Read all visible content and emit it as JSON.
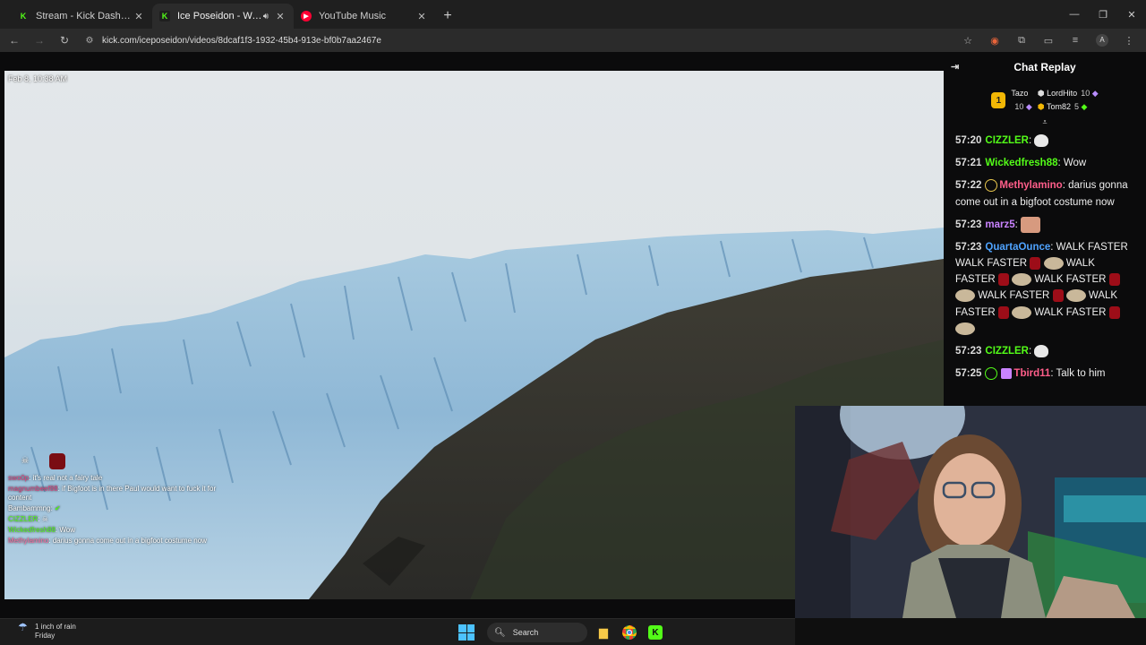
{
  "browser": {
    "tabs": [
      {
        "title": "Stream - Kick Dashboard",
        "favicon": "kick-icon",
        "active": false
      },
      {
        "title": "Ice Poseidon - Watch the V",
        "favicon": "kick-icon",
        "active": true
      },
      {
        "title": "YouTube Music",
        "favicon": "youtube-music-icon",
        "active": false
      }
    ],
    "url": "kick.com/iceposeidon/videos/8dcaf1f3-1932-45b4-913e-bf0b7aa2467e"
  },
  "video": {
    "timestamp": "Feb 8, 10:38 AM",
    "overlay_chat": [
      {
        "user": "swo0p",
        "text": "it's real not a fairy tale"
      },
      {
        "user": "magnumbeef88",
        "text": "if Bigfoot is in there Paul would want to fuck it for content"
      },
      {
        "user": "Bambammng",
        "text": ""
      },
      {
        "user": "CIZZLER",
        "text": ""
      },
      {
        "user": "Wickedfresh88",
        "text": "Wow"
      },
      {
        "user": "Methylamino",
        "text": "darius gonna come out in a bigfoot costume now"
      }
    ],
    "overlay_badge_text": "x2"
  },
  "chat": {
    "title": "Chat Replay",
    "leaderboard": [
      {
        "rank": "1",
        "name": "Tazo",
        "value": "10"
      },
      {
        "name": "LordHito",
        "value": "10"
      },
      {
        "name": "Tom82",
        "value": "5"
      }
    ],
    "messages": [
      {
        "time": "57:20",
        "user": "CIZZLER",
        "text": ""
      },
      {
        "time": "57:21",
        "user": "Wickedfresh88",
        "text": "Wow"
      },
      {
        "time": "57:22",
        "user": "Methylamino",
        "text": "darius gonna come out in a bigfoot costume now"
      },
      {
        "time": "57:23",
        "user": "marz5",
        "text": ""
      },
      {
        "time": "57:23",
        "user": "QuartaOunce",
        "walk": "WALK FASTER"
      },
      {
        "time": "57:23",
        "user": "CIZZLER",
        "text": ""
      },
      {
        "time": "57:25",
        "user": "Tbird11",
        "text": "Talk to him"
      }
    ]
  },
  "taskbar": {
    "weather_line1": "1 inch of rain",
    "weather_line2": "Friday",
    "search_label": "Search"
  },
  "colors": {
    "kick_green": "#53fc18",
    "chat_bg": "#0b0b0c"
  }
}
